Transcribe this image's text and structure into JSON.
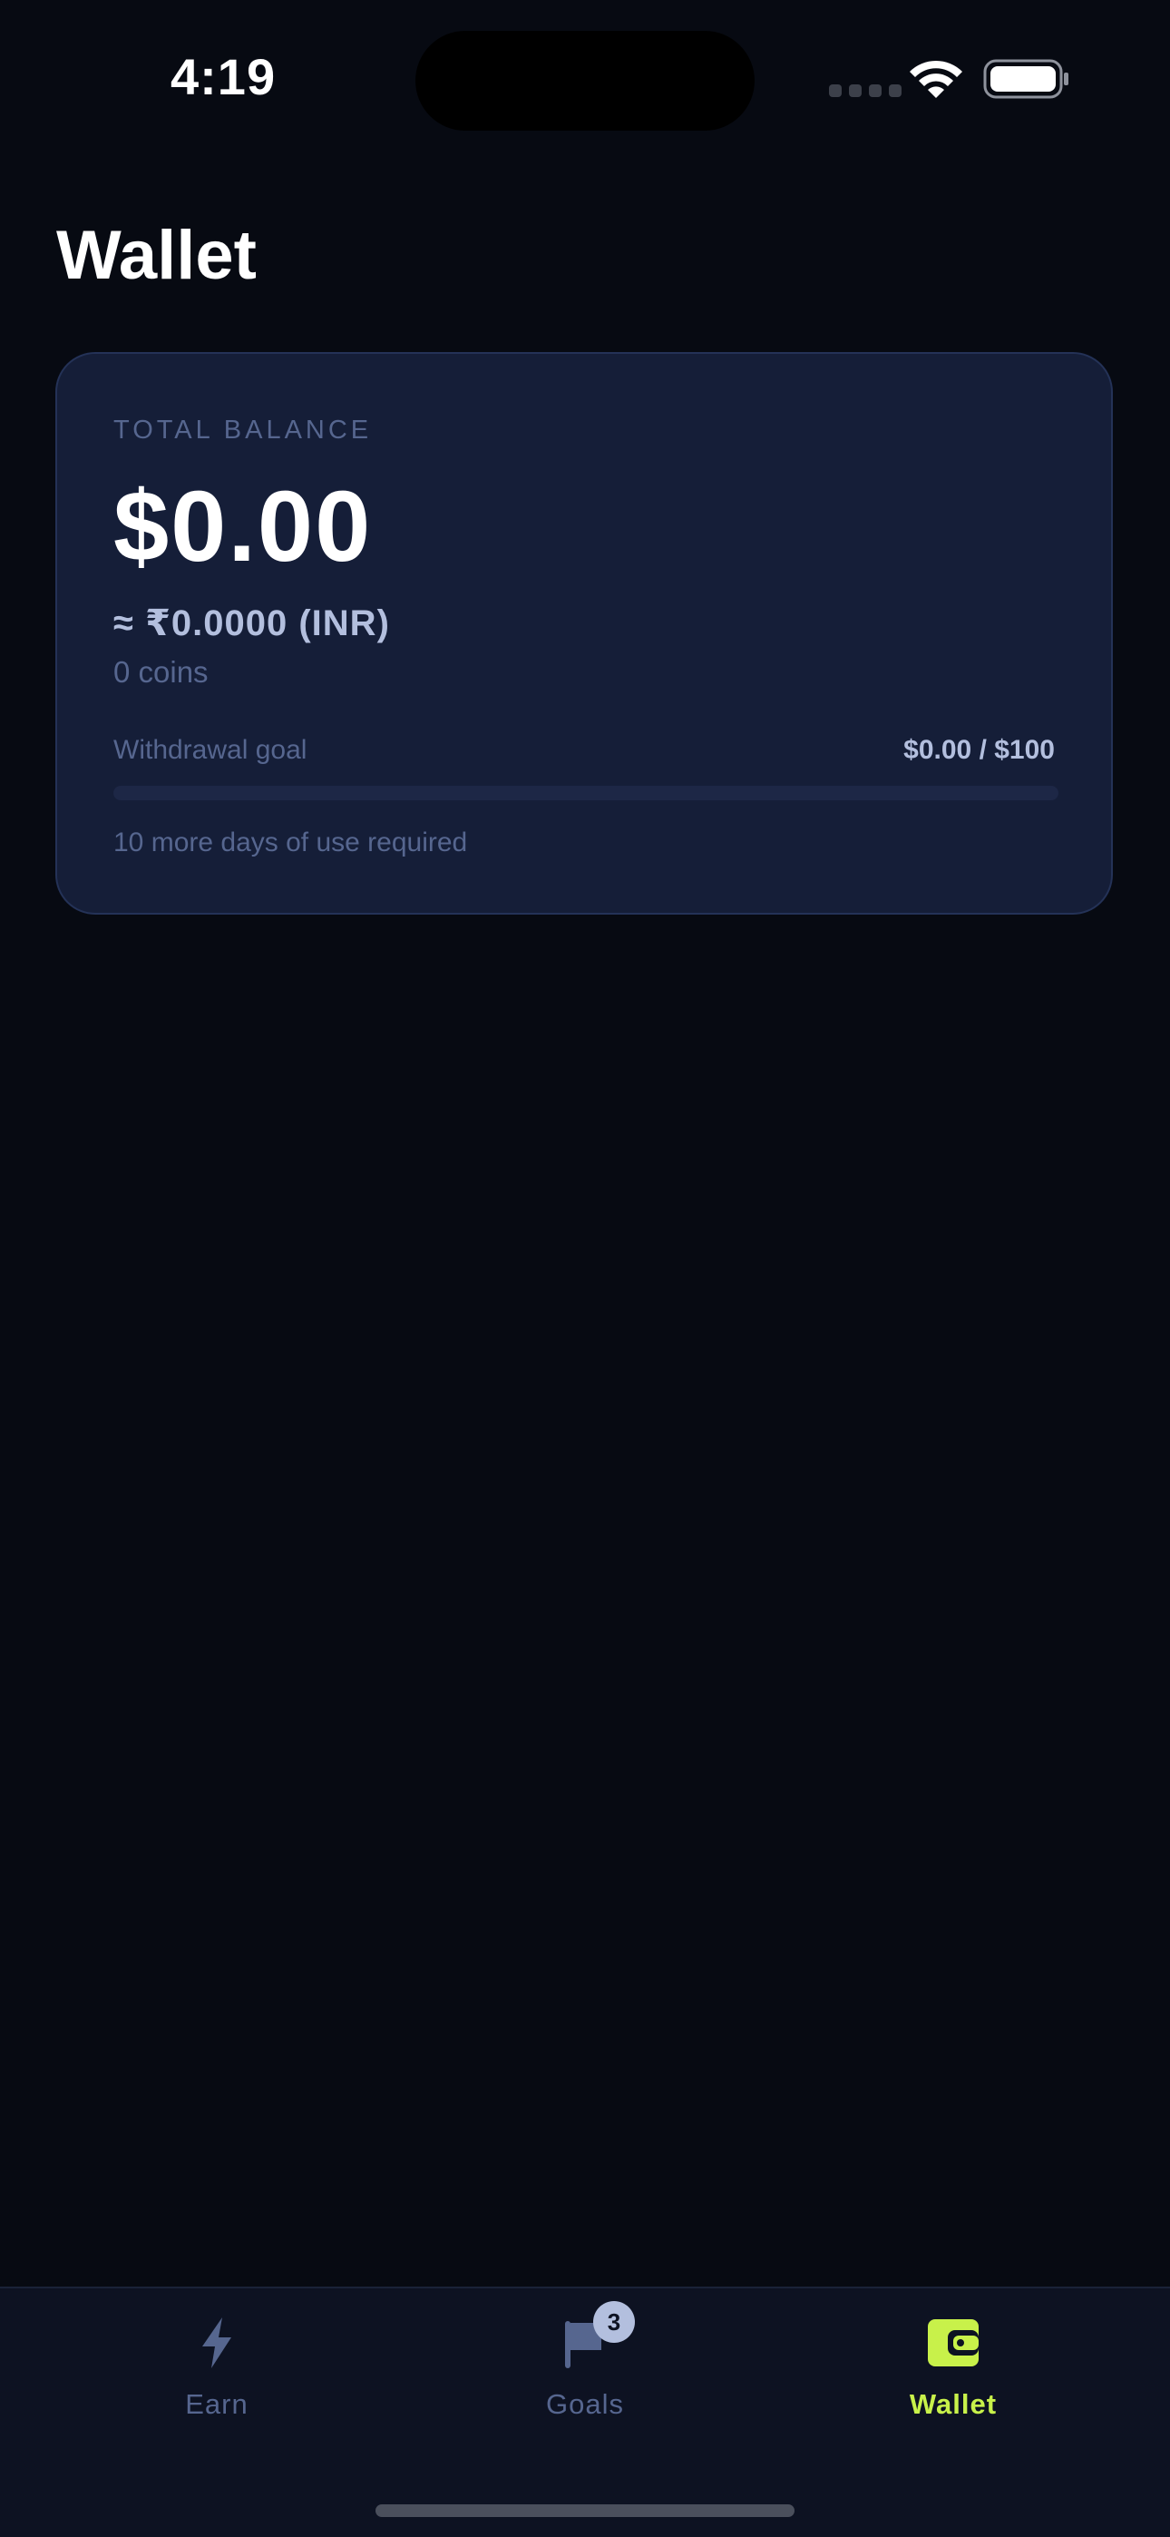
{
  "status_bar": {
    "time": "4:19"
  },
  "page": {
    "title": "Wallet"
  },
  "balance_card": {
    "label": "TOTAL BALANCE",
    "usd": "$0.00",
    "inr": "≈ ₹0.0000 (INR)",
    "coins": "0 coins",
    "goal_label": "Withdrawal goal",
    "goal_value": "$0.00 / $100",
    "goal_progress_percent": 0,
    "goal_note": "10 more days of use required"
  },
  "tab_bar": {
    "tabs": [
      {
        "label": "Earn",
        "icon": "lightning-icon",
        "active": false
      },
      {
        "label": "Goals",
        "icon": "flag-icon",
        "active": false,
        "badge": "3"
      },
      {
        "label": "Wallet",
        "icon": "wallet-icon",
        "active": true
      }
    ]
  },
  "colors": {
    "background": "#070A12",
    "card": "#151E38",
    "accent": "#C8F14A",
    "muted": "#56668F",
    "secondary_text": "#B3BFDE"
  }
}
